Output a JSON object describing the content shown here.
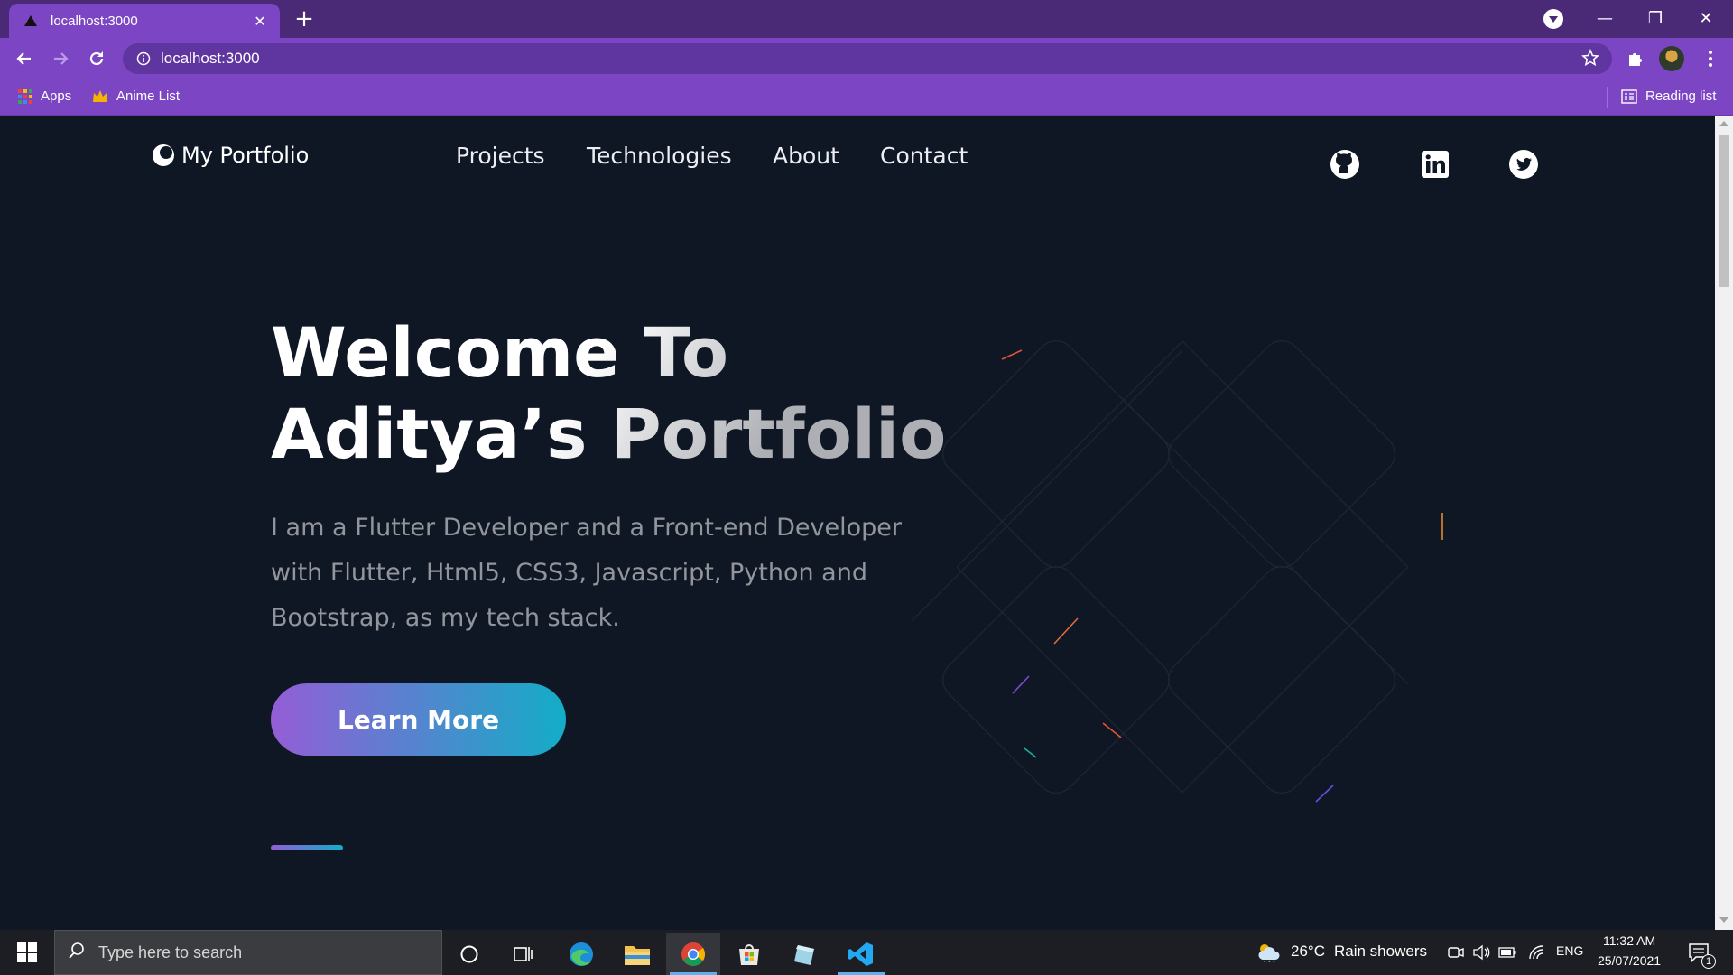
{
  "browser": {
    "tab_title": "localhost:3000",
    "tab_close": "✕",
    "new_tab": "+",
    "url": "localhost:3000",
    "window_buttons": {
      "minimize": "—",
      "restore": "❐",
      "close": "✕"
    },
    "bookmarks": [
      {
        "label": "Apps",
        "icon": "apps-grid-icon"
      },
      {
        "label": "Anime List",
        "icon": "crown-icon"
      }
    ],
    "reading_list": "Reading list"
  },
  "page": {
    "logo_text": "My Portfolio",
    "menu": [
      "Projects",
      "Technologies",
      "About",
      "Contact"
    ],
    "social": [
      "github-icon",
      "linkedin-icon",
      "twitter-icon"
    ],
    "hero": {
      "title_line1": "Welcome To",
      "title_line2": "Aditya’s Portfolio",
      "description": "I am a Flutter Developer and a Front-end Developer with Flutter, Html5, CSS3, Javascript, Python and Bootstrap, as my tech stack.",
      "cta_label": "Learn More"
    },
    "colors": {
      "background": "#0f1624",
      "gradient_start": "#945dd6",
      "gradient_end": "#13adc7"
    }
  },
  "taskbar": {
    "search_placeholder": "Type here to search",
    "weather_temp": "26°C",
    "weather_text": "Rain showers",
    "language": "ENG",
    "time": "11:32 AM",
    "date": "25/07/2021",
    "notification_count": "1"
  }
}
